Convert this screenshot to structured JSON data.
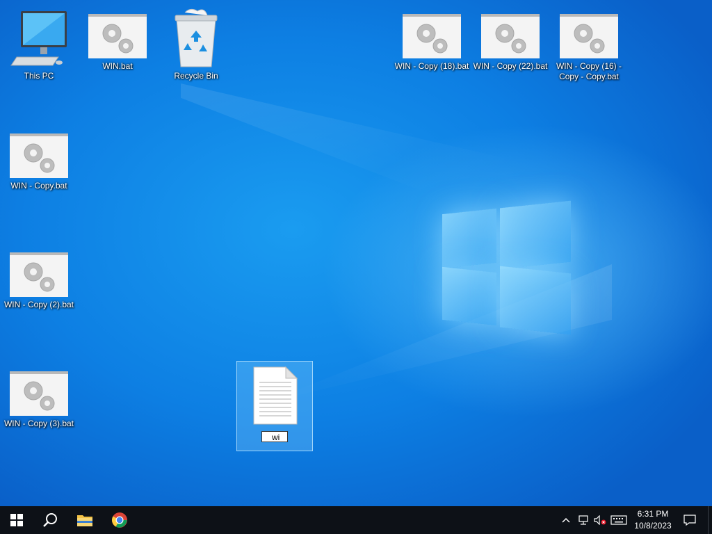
{
  "desktop": {
    "icons": [
      {
        "id": "this-pc",
        "label": "This PC",
        "type": "computer"
      },
      {
        "id": "win-bat",
        "label": "WIN.bat",
        "type": "batch"
      },
      {
        "id": "recycle-bin",
        "label": "Recycle Bin",
        "type": "recycle"
      },
      {
        "id": "win-copy-18",
        "label": "WIN - Copy (18).bat",
        "type": "batch"
      },
      {
        "id": "win-copy-22",
        "label": "WIN - Copy (22).bat",
        "type": "batch"
      },
      {
        "id": "win-copy-16",
        "label": "WIN - Copy (16) -\nCopy - Copy.bat",
        "type": "batch"
      },
      {
        "id": "win-copy",
        "label": "WIN - Copy.bat",
        "type": "batch"
      },
      {
        "id": "win-copy-2",
        "label": "WIN - Copy (2).bat",
        "type": "batch"
      },
      {
        "id": "win-copy-3",
        "label": "WIN - Copy (3).bat",
        "type": "batch"
      }
    ],
    "new_file": {
      "rename_value": "wi",
      "icon": "text-document-icon"
    }
  },
  "taskbar": {
    "start_icon": "windows-start-icon",
    "search_icon": "search-icon",
    "pinned": [
      {
        "name": "file-explorer",
        "icon": "folder-icon"
      },
      {
        "name": "chrome",
        "icon": "chrome-icon"
      }
    ],
    "tray": {
      "chevron_icon": "chevron-up-icon",
      "network_icon": "network-icon",
      "volume_icon": "volume-muted-icon",
      "keyboard_icon": "keyboard-icon",
      "notification_icon": "notification-icon"
    },
    "clock": {
      "time": "6:31 PM",
      "date": "10/8/2023"
    }
  },
  "colors": {
    "desktop_blue": "#0d7fe3",
    "taskbar": "#0d1117",
    "selection": "#78c8ff"
  }
}
